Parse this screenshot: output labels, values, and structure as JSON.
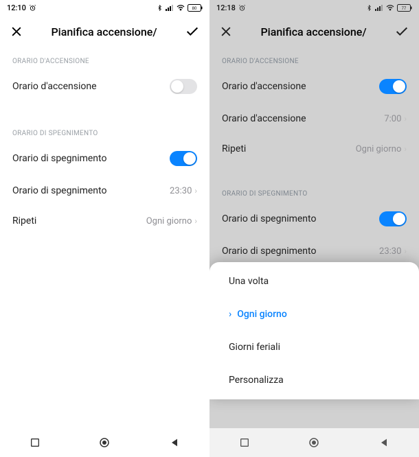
{
  "left": {
    "status": {
      "time": "12:10",
      "battery": "80"
    },
    "header": {
      "title": "Pianifica accensione/"
    },
    "section1_label": "ORARIO D'ACCENSIONE",
    "row_on_toggle_label": "Orario d'accensione",
    "section2_label": "ORARIO DI SPEGNIMENTO",
    "row_off_toggle_label": "Orario di spegnimento",
    "row_off_time_label": "Orario di spegnimento",
    "row_off_time_value": "23:30",
    "row_repeat_label": "Ripeti",
    "row_repeat_value": "Ogni giorno"
  },
  "right": {
    "status": {
      "time": "12:18",
      "battery": "77"
    },
    "header": {
      "title": "Pianifica accensione/"
    },
    "section1_label": "ORARIO D'ACCENSIONE",
    "row_on_toggle_label": "Orario d'accensione",
    "row_on_time_label": "Orario d'accensione",
    "row_on_time_value": "7:00",
    "row_repeat_label": "Ripeti",
    "row_repeat_value": "Ogni giorno",
    "section2_label": "ORARIO DI SPEGNIMENTO",
    "row_off_toggle_label": "Orario di spegnimento",
    "row_off_time_label": "Orario di spegnimento",
    "row_off_time_value": "23:30",
    "sheet": {
      "options": [
        {
          "label": "Una volta",
          "selected": false
        },
        {
          "label": "Ogni giorno",
          "selected": true
        },
        {
          "label": "Giorni feriali",
          "selected": false
        },
        {
          "label": "Personalizza",
          "selected": false
        }
      ]
    }
  }
}
